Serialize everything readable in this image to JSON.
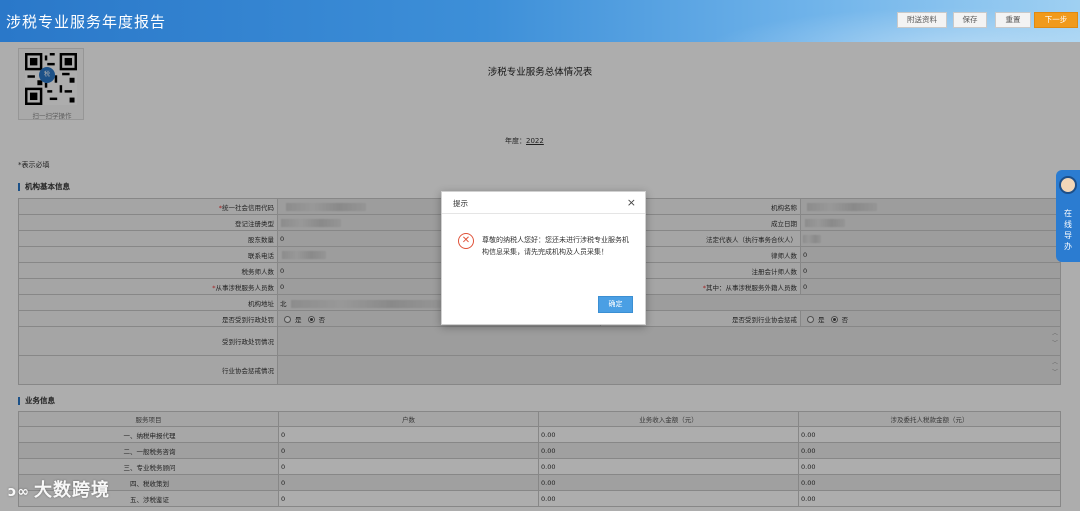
{
  "header": {
    "title": "涉税专业服务年度报告",
    "buttons": {
      "attach": "附送资料",
      "save": "保存",
      "reset": "重置",
      "next": "下一步"
    }
  },
  "qr": {
    "caption": "扫一扫学操作",
    "logo": "税"
  },
  "form": {
    "title": "涉税专业服务总体情况表",
    "year_label": "年度：",
    "year": "2022",
    "required_note": "*表示必填"
  },
  "basic": {
    "section_title": "机构基本信息",
    "labels": {
      "credit_code": "统一社会信用代码",
      "org_name": "机构名称",
      "reg_type": "登记注册类型",
      "established": "成立日期",
      "shareholders": "股东数量",
      "legal_rep": "法定代表人（执行事务合伙人）",
      "phone": "联系电话",
      "lawyers": "律师人数",
      "tax_agents": "税务师人数",
      "accountants": "注册会计师人数",
      "staff": "从事涉税服务人员数",
      "external": "其中：从事涉税服务外籍人员数",
      "address": "机构地址",
      "admin_penalty": "是否受到行政处罚",
      "assoc_penalty": "是否受到行业协会惩戒",
      "penalty_detail": "受到行政处罚情况",
      "assoc_detail": "行业协会惩戒情况"
    },
    "values": {
      "shareholders": "0",
      "lawyers": "0",
      "tax_agents": "0",
      "accountants": "0",
      "staff": "0",
      "external": "0",
      "address_prefix": "北"
    },
    "radio": {
      "yes": "是",
      "no": "否"
    }
  },
  "business": {
    "section_title": "业务信息",
    "columns": [
      "服务项目",
      "户数",
      "业务收入金额（元）",
      "涉及委托人税款金额（元）"
    ],
    "rows": [
      {
        "item": "一、纳税申报代理",
        "households": "0",
        "income": "0.00",
        "tax": "0.00"
      },
      {
        "item": "二、一般税务咨询",
        "households": "0",
        "income": "0.00",
        "tax": "0.00"
      },
      {
        "item": "三、专业税务顾问",
        "households": "0",
        "income": "0.00",
        "tax": "0.00"
      },
      {
        "item": "四、税收策划",
        "households": "0",
        "income": "0.00",
        "tax": "0.00"
      },
      {
        "item": "五、涉税鉴证",
        "households": "0",
        "income": "0.00",
        "tax": "0.00"
      }
    ]
  },
  "dialog": {
    "title": "提示",
    "message": "尊敬的纳税人您好：您还未进行涉税专业服务机构信息采集，请先完成机构及人员采集！",
    "ok": "确定",
    "close": "×"
  },
  "guide": {
    "text": "在线导办"
  },
  "watermark": {
    "text": "大数跨境",
    "logo": "ↄ∞"
  },
  "colors": {
    "header": "#2a78c9",
    "next_button": "#f19a1b",
    "ok_button": "#4a9fe4",
    "error_icon": "#e0533a"
  }
}
